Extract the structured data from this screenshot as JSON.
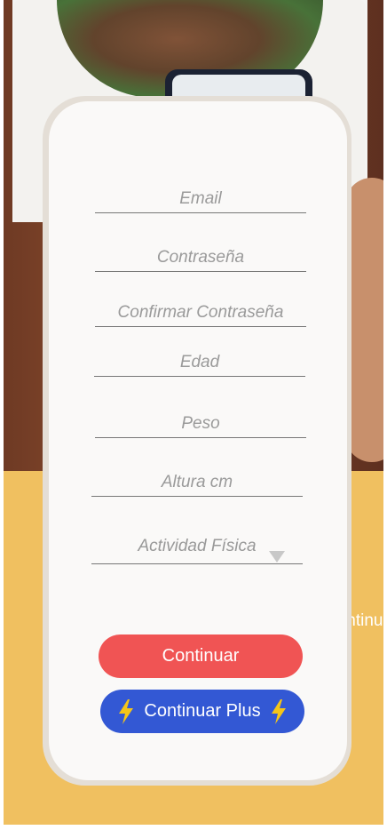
{
  "form": {
    "email_placeholder": "Email",
    "password_placeholder": "Contraseña",
    "confirm_password_placeholder": "Confirmar Contraseña",
    "age_placeholder": "Edad",
    "weight_placeholder": "Peso",
    "height_placeholder": "Altura cm",
    "activity_label": "Actividad Física"
  },
  "buttons": {
    "continue_label": "Continuar",
    "continue_plus_label": "Continuar Plus"
  },
  "background": {
    "peek_label": "Continu"
  },
  "colors": {
    "accent_yellow": "#f0c060",
    "continue_red": "#f05454",
    "plus_blue": "#3358d4",
    "bolt_yellow": "#f5c518"
  },
  "icons": {
    "bolt": "lightning-bolt-icon",
    "dropdown": "triangle-down-icon"
  }
}
